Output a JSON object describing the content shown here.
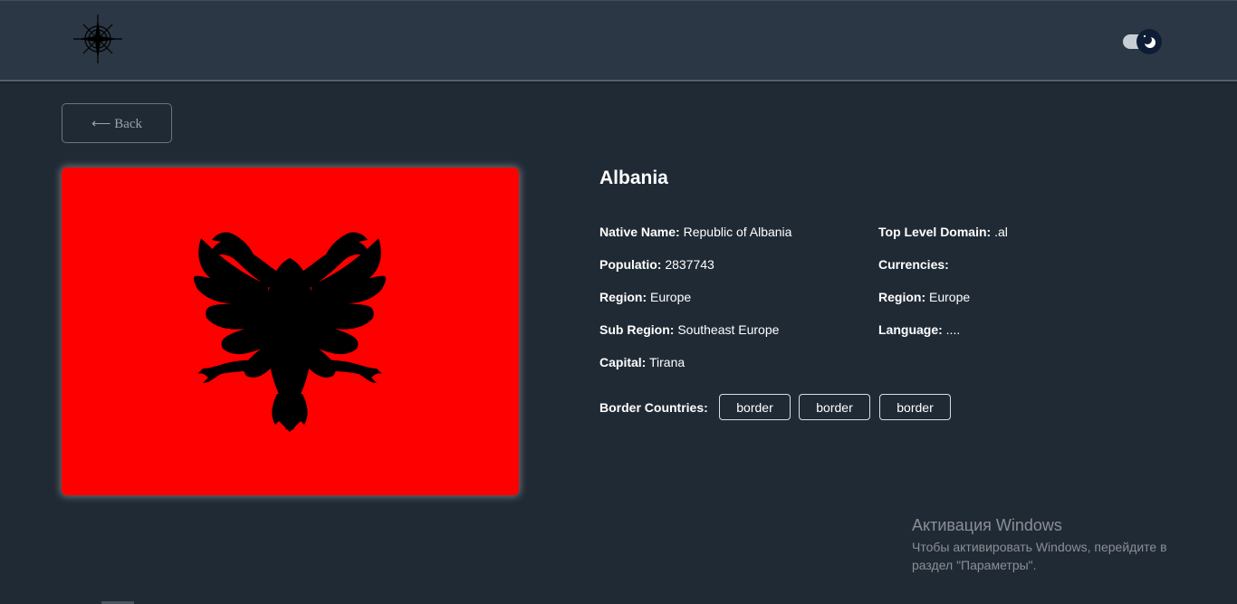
{
  "header": {
    "logo_icon": "compass-rose-icon",
    "theme_toggle_icon": "moon-icon"
  },
  "back_button": {
    "label": "⟵ Back"
  },
  "flag": {
    "alt": "Flag of Albania",
    "colors": {
      "field": "#ff0000",
      "eagle": "#000000"
    }
  },
  "country": {
    "name": "Albania",
    "left_details": [
      {
        "label": "Native Name:",
        "value": "Republic of Albania"
      },
      {
        "label": "Populatio:",
        "value": "2837743"
      },
      {
        "label": "Region:",
        "value": "Europe"
      },
      {
        "label": "Sub Region:",
        "value": "Southeast Europe"
      },
      {
        "label": "Capital:",
        "value": "Tirana"
      }
    ],
    "right_details": [
      {
        "label": "Top Level Domain:",
        "value": ".al"
      },
      {
        "label": "Currencies:",
        "value": ""
      },
      {
        "label": "Region:",
        "value": "Europe"
      },
      {
        "label": "Language:",
        "value": "...."
      }
    ],
    "border_label": "Border Countries:",
    "borders": [
      "border",
      "border",
      "border"
    ]
  },
  "watermark": {
    "title": "Активация Windows",
    "text": "Чтобы активировать Windows, перейдите в раздел \"Параметры\"."
  },
  "colors": {
    "background": "#202a35",
    "header": "#2b3744",
    "text": "#ffffff"
  }
}
